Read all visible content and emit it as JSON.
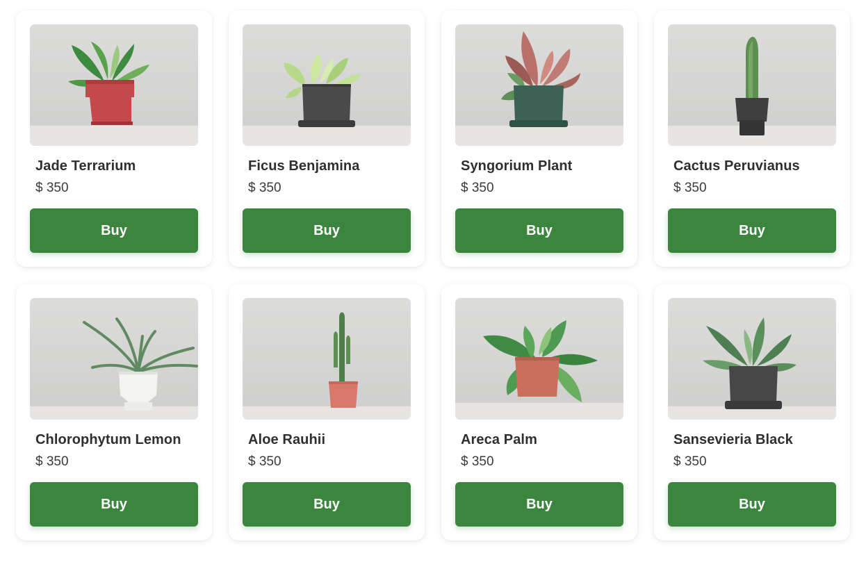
{
  "products": [
    {
      "name": "Jade Terrarium",
      "price": "$ 350",
      "buy_label": "Buy",
      "image_icon": "plant-in-red-pot-icon",
      "pot_color": "#c5494a"
    },
    {
      "name": "Ficus Benjamina",
      "price": "$ 350",
      "buy_label": "Buy",
      "image_icon": "plant-in-dark-pot-icon",
      "pot_color": "#4a4a4a"
    },
    {
      "name": "Syngorium Plant",
      "price": "$ 350",
      "buy_label": "Buy",
      "image_icon": "plant-in-green-pot-icon",
      "pot_color": "#3b6254"
    },
    {
      "name": "Cactus Peruvianus",
      "price": "$ 350",
      "buy_label": "Buy",
      "image_icon": "cactus-in-dark-pot-icon",
      "pot_color": "#3f3f3f"
    },
    {
      "name": "Chlorophytum Lemon",
      "price": "$ 350",
      "buy_label": "Buy",
      "image_icon": "plant-in-white-pot-icon",
      "pot_color": "#f2f2f2"
    },
    {
      "name": "Aloe Rauhii",
      "price": "$ 350",
      "buy_label": "Buy",
      "image_icon": "cactus-in-terracotta-pot-icon",
      "pot_color": "#d7786a"
    },
    {
      "name": "Areca Palm",
      "price": "$ 350",
      "buy_label": "Buy",
      "image_icon": "plant-in-terracotta-pot-icon",
      "pot_color": "#cc6e5c"
    },
    {
      "name": "Sansevieria Black",
      "price": "$ 350",
      "buy_label": "Buy",
      "image_icon": "plant-in-dark-pot-icon",
      "pot_color": "#474747"
    }
  ],
  "colors": {
    "accent": "#3b853f",
    "text": "#2f2f2f"
  }
}
